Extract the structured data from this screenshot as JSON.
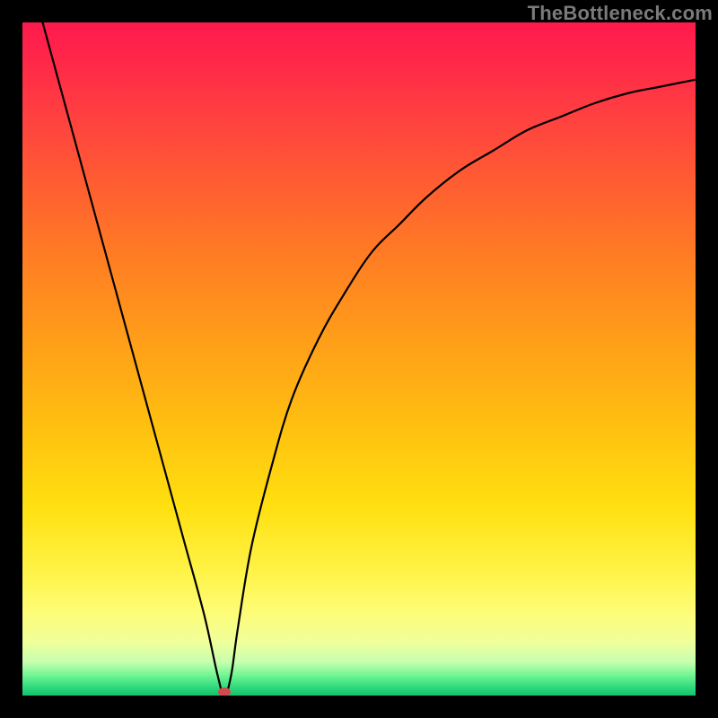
{
  "watermark": "TheBottleneck.com",
  "chart_data": {
    "type": "line",
    "title": "",
    "xlabel": "",
    "ylabel": "",
    "xlim": [
      0,
      100
    ],
    "ylim": [
      0,
      100
    ],
    "grid": false,
    "legend": false,
    "series": [
      {
        "name": "bottleneck-curve",
        "color": "#000000",
        "x": [
          3,
          6,
          9,
          12,
          15,
          18,
          21,
          24,
          27,
          29,
          30,
          31,
          32,
          34,
          37,
          40,
          44,
          48,
          52,
          56,
          60,
          65,
          70,
          75,
          80,
          85,
          90,
          95,
          100
        ],
        "y": [
          100,
          89,
          78,
          67,
          56,
          45,
          34,
          23,
          12,
          3,
          0,
          3,
          10,
          22,
          34,
          44,
          53,
          60,
          66,
          70,
          74,
          78,
          81,
          84,
          86,
          88,
          89.5,
          90.5,
          91.5
        ]
      }
    ],
    "marker": {
      "name": "optimum-marker",
      "x": 30,
      "y": 0,
      "color": "#d24a4a"
    },
    "gradient": {
      "stops": [
        {
          "pos": 0,
          "color": "#ff1a4d"
        },
        {
          "pos": 14,
          "color": "#ff4040"
        },
        {
          "pos": 36,
          "color": "#ff8022"
        },
        {
          "pos": 60,
          "color": "#ffc010"
        },
        {
          "pos": 82,
          "color": "#fff44a"
        },
        {
          "pos": 95,
          "color": "#c8ffb0"
        },
        {
          "pos": 100,
          "color": "#18c06c"
        }
      ]
    }
  }
}
